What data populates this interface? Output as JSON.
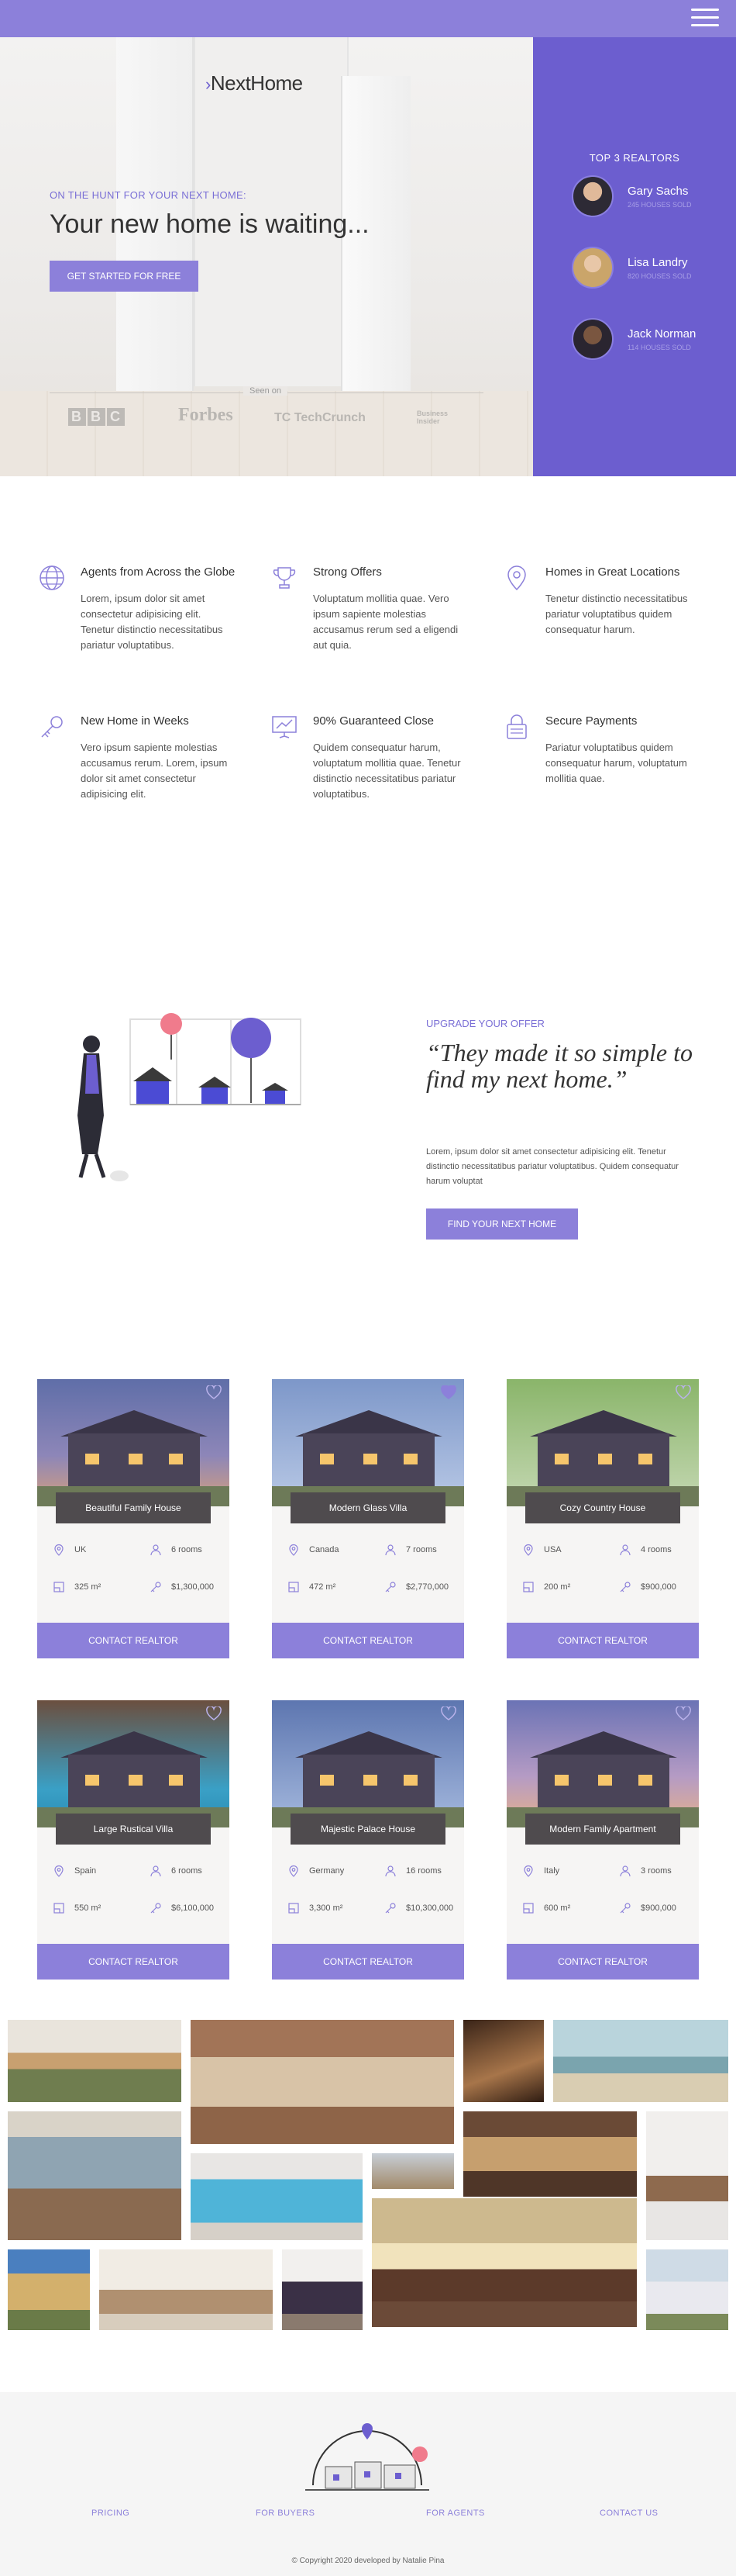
{
  "nav": {
    "menu_icon": "hamburger-menu-icon"
  },
  "hero": {
    "logo": "NextHome",
    "kicker": "ON THE HUNT FOR YOUR NEXT HOME:",
    "title": "Your new home is waiting...",
    "cta_label": "GET STARTED FOR FREE",
    "seen_on_label": "Seen on",
    "press": [
      "BBC",
      "Forbes",
      "TechCrunch",
      "Business Insider"
    ]
  },
  "realtors": {
    "title": "TOP 3 REALTORS",
    "items": [
      {
        "name": "Gary Sachs",
        "sold": "245 HOUSES SOLD"
      },
      {
        "name": "Lisa Landry",
        "sold": "820 HOUSES SOLD"
      },
      {
        "name": "Jack Norman",
        "sold": "114 HOUSES SOLD"
      }
    ]
  },
  "features": [
    {
      "icon": "globe-icon",
      "title": "Agents from Across the Globe",
      "text": "Lorem, ipsum dolor sit amet consectetur adipisicing elit. Tenetur distinctio necessitatibus pariatur voluptatibus."
    },
    {
      "icon": "trophy-icon",
      "title": "Strong Offers",
      "text": "Voluptatum mollitia quae. Vero ipsum sapiente molestias accusamus rerum sed a eligendi aut quia."
    },
    {
      "icon": "map-pin-icon",
      "title": "Homes in Great Locations",
      "text": "Tenetur distinctio necessitatibus pariatur voluptatibus quidem consequatur harum."
    },
    {
      "icon": "key-icon",
      "title": "New Home in Weeks",
      "text": "Vero ipsum sapiente molestias accusamus rerum. Lorem, ipsum dolor sit amet consectetur adipisicing elit."
    },
    {
      "icon": "chart-presentation-icon",
      "title": "90% Guaranteed Close",
      "text": "Quidem consequatur harum, voluptatum mollitia quae. Tenetur distinctio necessitatibus pariatur voluptatibus."
    },
    {
      "icon": "lock-icon",
      "title": "Secure Payments",
      "text": "Pariatur voluptatibus quidem consequatur harum, voluptatum mollitia quae."
    }
  ],
  "testimonial": {
    "kicker": "UPGRADE YOUR OFFER",
    "quote": "“They made it so simple to find my next home.”",
    "text": "Lorem, ipsum dolor sit amet consectetur adipisicing elit. Tenetur distinctio necessitatibus pariatur voluptatibus. Quidem consequatur harum voluptat",
    "cta_label": "FIND YOUR NEXT HOME"
  },
  "listings": [
    {
      "name": "Beautiful Family House",
      "country": "UK",
      "rooms": "6 rooms",
      "area": "325 m²",
      "price": "$1,300,000",
      "button": "CONTACT REALTOR",
      "favorite": false
    },
    {
      "name": "Modern Glass Villa",
      "country": "Canada",
      "rooms": "7 rooms",
      "area": "472 m²",
      "price": "$2,770,000",
      "button": "CONTACT REALTOR",
      "favorite": true
    },
    {
      "name": "Cozy Country House",
      "country": "USA",
      "rooms": "4 rooms",
      "area": "200 m²",
      "price": "$900,000",
      "button": "CONTACT REALTOR",
      "favorite": false
    },
    {
      "name": "Large Rustical Villa",
      "country": "Spain",
      "rooms": "6 rooms",
      "area": "550 m²",
      "price": "$6,100,000",
      "button": "CONTACT REALTOR",
      "favorite": false
    },
    {
      "name": "Majestic Palace House",
      "country": "Germany",
      "rooms": "16 rooms",
      "area": "3,300 m²",
      "price": "$10,300,000",
      "button": "CONTACT REALTOR",
      "favorite": false
    },
    {
      "name": "Modern Family Apartment",
      "country": "Italy",
      "rooms": "3 rooms",
      "area": "600 m²",
      "price": "$900,000",
      "button": "CONTACT REALTOR",
      "favorite": false
    }
  ],
  "footer": {
    "links": [
      "PRICING",
      "FOR BUYERS",
      "FOR AGENTS",
      "CONTACT US"
    ],
    "copyright": "© Copyright 2020 developed by Natalie Pina"
  },
  "colors": {
    "accent": "#8c80da",
    "accent_dark": "#6c5ecf",
    "label_bg": "#4f4b4e"
  }
}
